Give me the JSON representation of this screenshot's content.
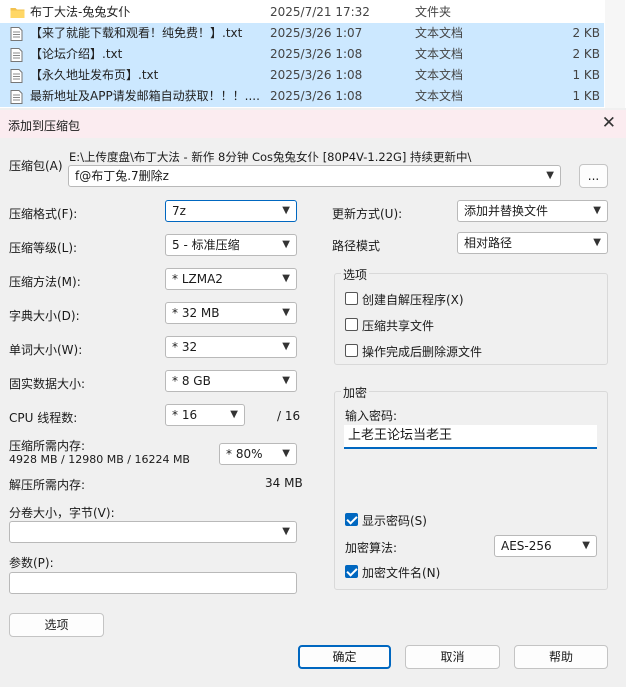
{
  "file_list": {
    "folder": {
      "name": "布丁大法-兔兔女仆",
      "date": "2025/7/21 17:32",
      "type": "文件夹",
      "icon": "folder-icon"
    },
    "files": [
      {
        "name": "【来了就能下载和观看！纯免费！】.txt",
        "date": "2025/3/26 1:07",
        "type": "文本文档",
        "size": "2 KB"
      },
      {
        "name": "【论坛介绍】.txt",
        "date": "2025/3/26 1:08",
        "type": "文本文档",
        "size": "2 KB"
      },
      {
        "name": "【永久地址发布页】.txt",
        "date": "2025/3/26 1:08",
        "type": "文本文档",
        "size": "1 KB"
      },
      {
        "name": "最新地址及APP请发邮箱自动获取！！！....",
        "date": "2025/3/26 1:08",
        "type": "文本文档",
        "size": "1 KB"
      }
    ]
  },
  "dialog": {
    "title": "添加到压缩包",
    "archive_label": "压缩包(A)",
    "archive_path": "E:\\上传度盘\\布丁大法 - 新作 8分钟 Cos兔兔女仆 [80P4V-1.22G] 持续更新中\\",
    "archive_name": "f@布丁兔.7删除z",
    "browse": "...",
    "left": [
      {
        "label": "压缩格式(F):",
        "value": "7z"
      },
      {
        "label": "压缩等级(L):",
        "value": "5 - 标准压缩"
      },
      {
        "label": "压缩方法(M):",
        "value": "*  LZMA2"
      },
      {
        "label": "字典大小(D):",
        "value": "*  32 MB"
      },
      {
        "label": "单词大小(W):",
        "value": "*  32"
      },
      {
        "label": "固实数据大小:",
        "value": "*  8 GB"
      }
    ],
    "cpu": {
      "label": "CPU 线程数:",
      "value": "*  16",
      "max": "/ 16"
    },
    "mem": {
      "label": "压缩所需内存:",
      "detail": "4928 MB / 12980 MB / 16224 MB",
      "value": "*  80%"
    },
    "decomp": {
      "label": "解压所需内存:",
      "value": "34 MB"
    },
    "split": {
      "label": "分卷大小，字节(V):",
      "value": ""
    },
    "params": {
      "label": "参数(P):",
      "value": ""
    },
    "options_btn": "选项",
    "update": {
      "label": "更新方式(U):",
      "value": "添加并替换文件"
    },
    "pathmode": {
      "label": "路径模式",
      "value": "相对路径"
    },
    "options_group": {
      "title": "选项",
      "items": [
        {
          "label": "创建自解压程序(X)",
          "checked": false
        },
        {
          "label": "压缩共享文件",
          "checked": false
        },
        {
          "label": "操作完成后删除源文件",
          "checked": false
        }
      ]
    },
    "encrypt": {
      "title": "加密",
      "pwd_label": "输入密码:",
      "password": "上老王论坛当老王",
      "show_pwd": {
        "label": "显示密码(S)",
        "checked": true
      },
      "alg_label": "加密算法:",
      "alg_value": "AES-256",
      "enc_names": {
        "label": "加密文件名(N)",
        "checked": true
      }
    },
    "buttons": {
      "ok": "确定",
      "cancel": "取消",
      "help": "帮助"
    }
  },
  "colors": {
    "accent": "#0067c0",
    "selection": "#cce8ff",
    "titlebar": "#fbecf0"
  }
}
